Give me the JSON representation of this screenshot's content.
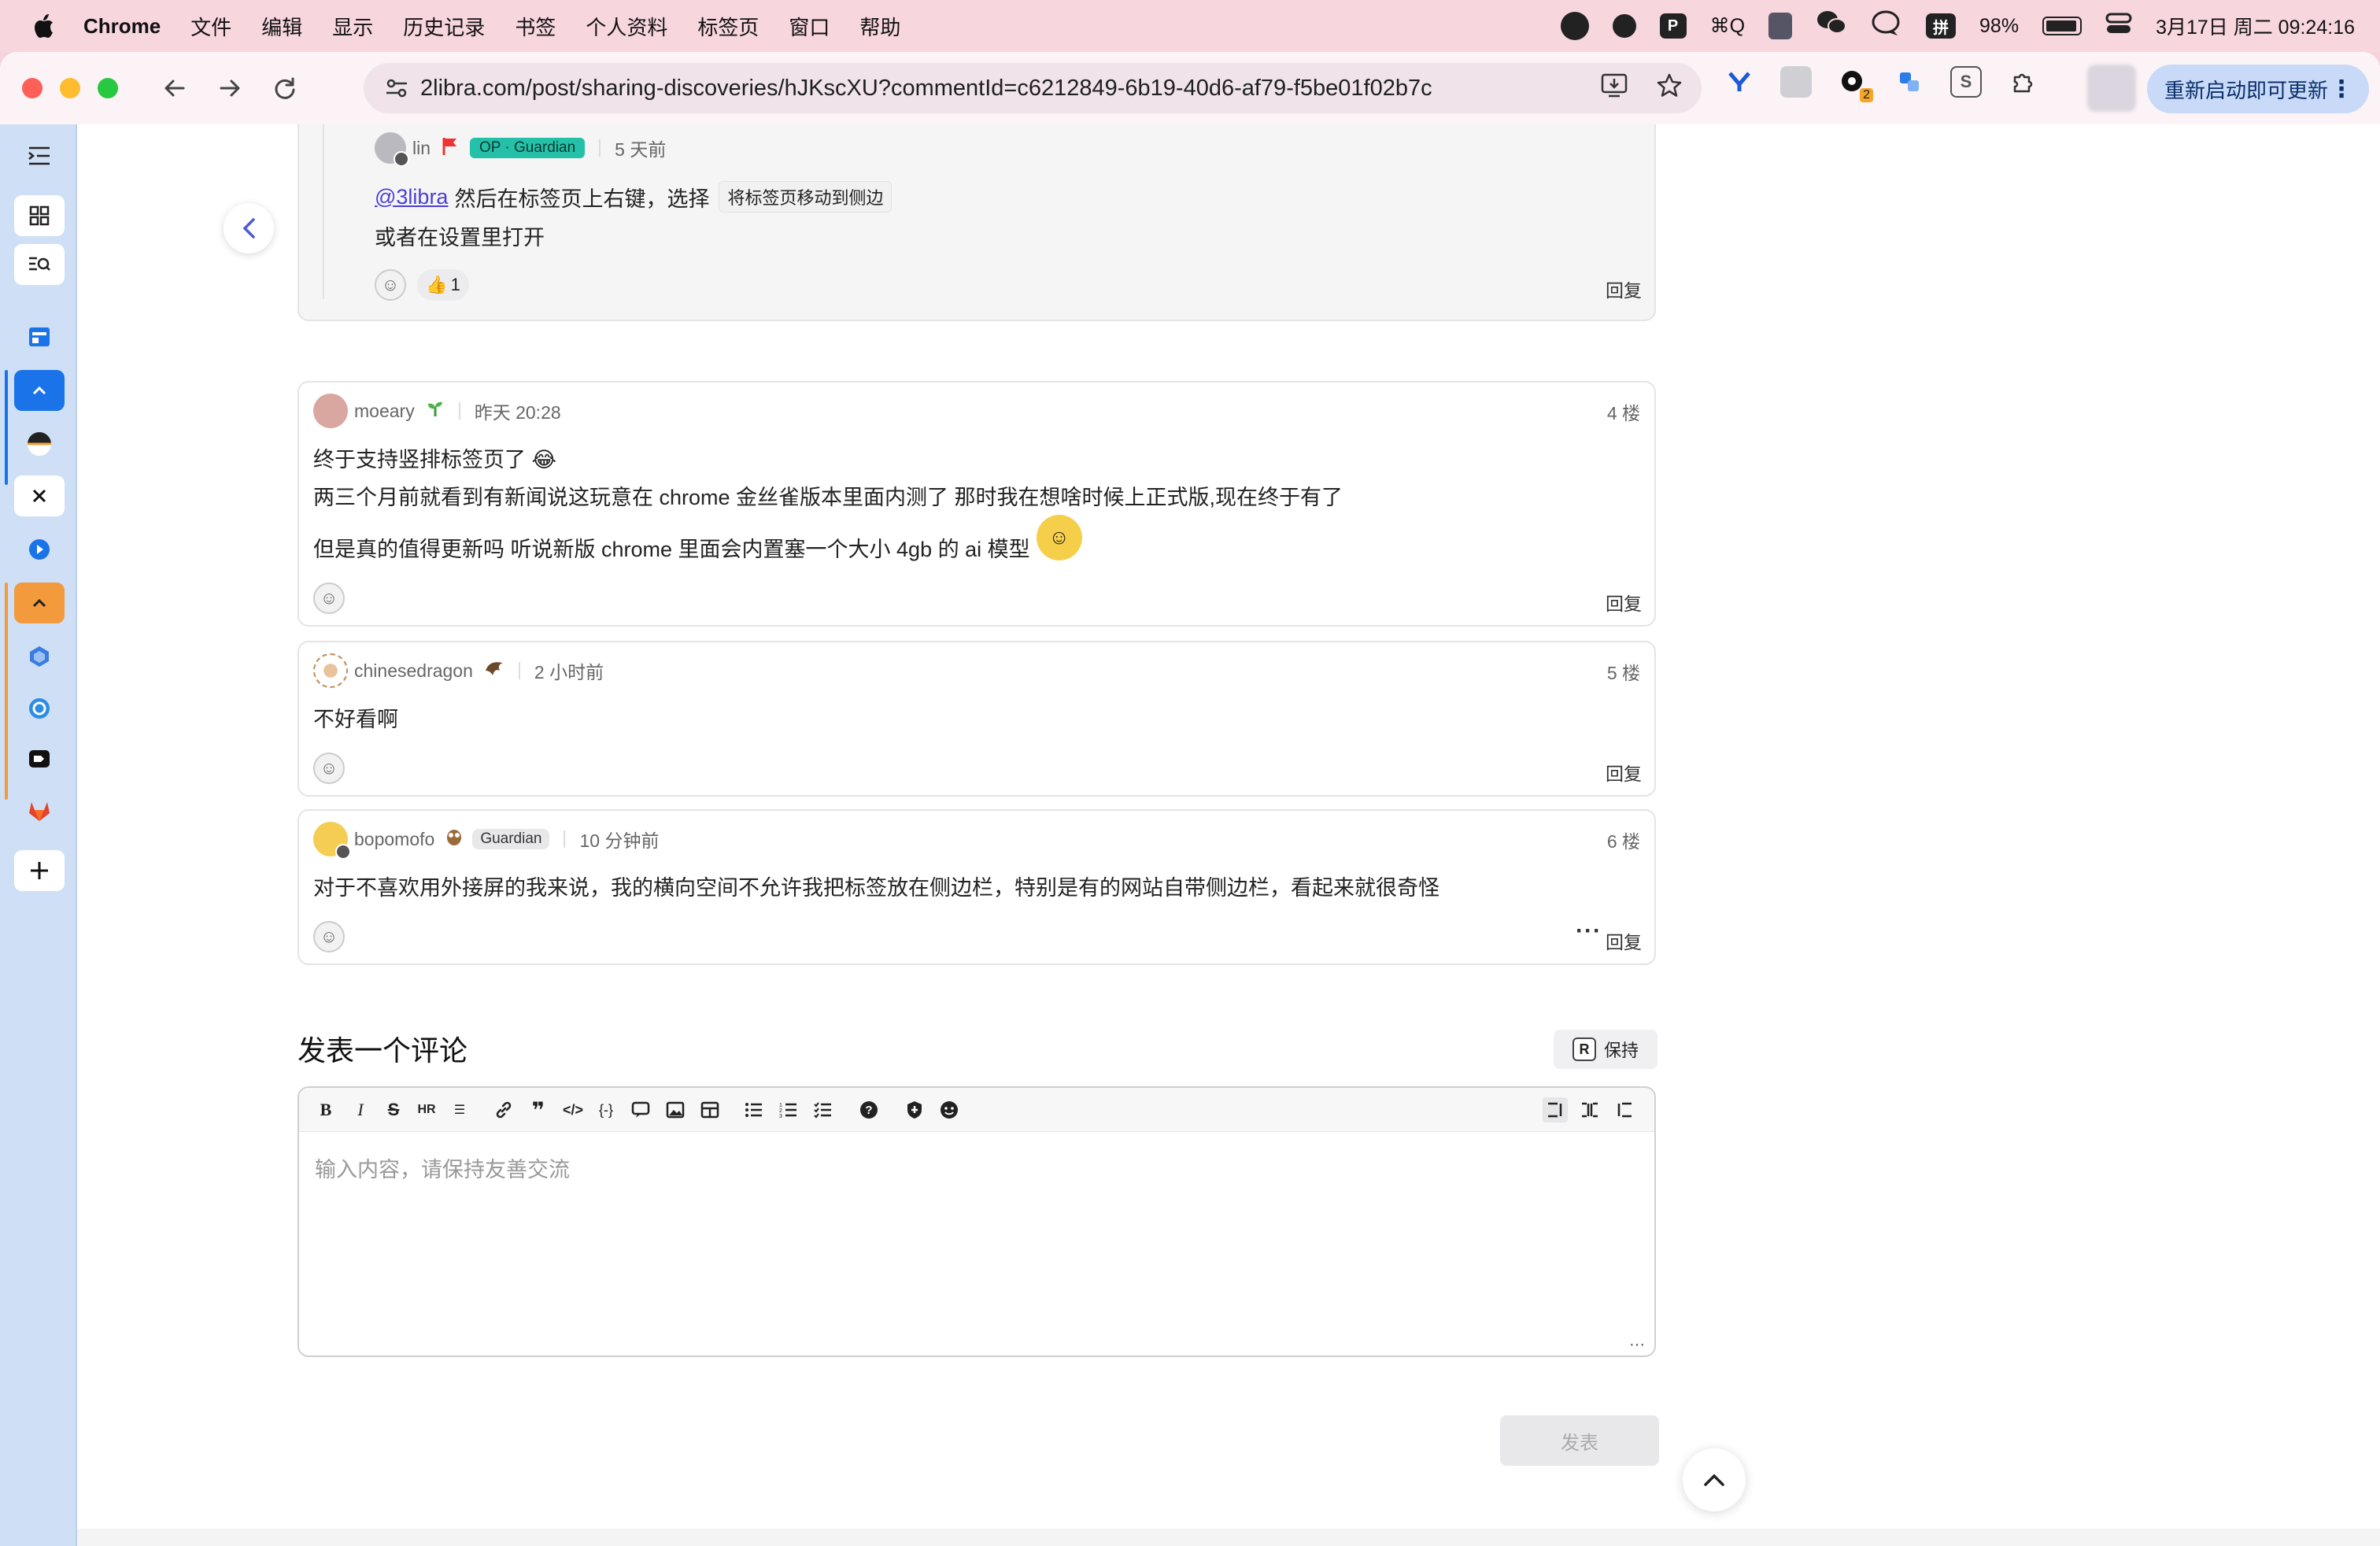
{
  "menubar": {
    "app": "Chrome",
    "items": [
      "文件",
      "编辑",
      "显示",
      "历史记录",
      "书签",
      "个人资料",
      "标签页",
      "窗口",
      "帮助"
    ],
    "shortcut": "⌘Q",
    "battery": "98%",
    "clock": "3月17日 周二  09:24:16",
    "ime": "拼"
  },
  "browser": {
    "url": "2libra.com/post/sharing-discoveries/hJKscXU?commentId=c6212849-6b19-40d6-af79-f5be01f02b7c",
    "update_label": "重新启动即可更新",
    "ext_badge": "2"
  },
  "comments": [
    {
      "user": "lin",
      "badge_op": "OP · Guardian",
      "time": "5 天前",
      "mention": "@3libra",
      "line1": "然后在标签页上右键，选择",
      "kbd": "将标签页移动到侧边",
      "line2": "或者在设置里打开",
      "likes": "1",
      "reply": "回复"
    },
    {
      "user": "moeary",
      "time": "昨天 20:28",
      "floor": "4 楼",
      "line1": "终于支持竖排标签页了 😂",
      "line2": "两三个月前就看到有新闻说这玩意在 chrome 金丝雀版本里面内测了 那时我在想啥时候上正式版,现在终于有了",
      "line3": "但是真的值得更新吗 听说新版 chrome 里面会内置塞一个大小 4gb 的 ai 模型",
      "reply": "回复"
    },
    {
      "user": "chinesedragon",
      "time": "2 小时前",
      "floor": "5 楼",
      "line1": "不好看啊",
      "reply": "回复"
    },
    {
      "user": "bopomofo",
      "badge": "Guardian",
      "time": "10 分钟前",
      "floor": "6 楼",
      "line1": "对于不喜欢用外接屏的我来说，我的横向空间不允许我把标签放在侧边栏，特别是有的网站自带侧边栏，看起来就很奇怪",
      "reply": "回复"
    }
  ],
  "compose": {
    "title": "发表一个评论",
    "keep_key": "R",
    "keep_label": "保持",
    "placeholder": "输入内容，请保持友善交流",
    "publish": "发表"
  },
  "colors": {
    "accent": "#4a5ad8",
    "op_badge": "#25c0a8",
    "tabstrip": "#cfe0f6"
  }
}
